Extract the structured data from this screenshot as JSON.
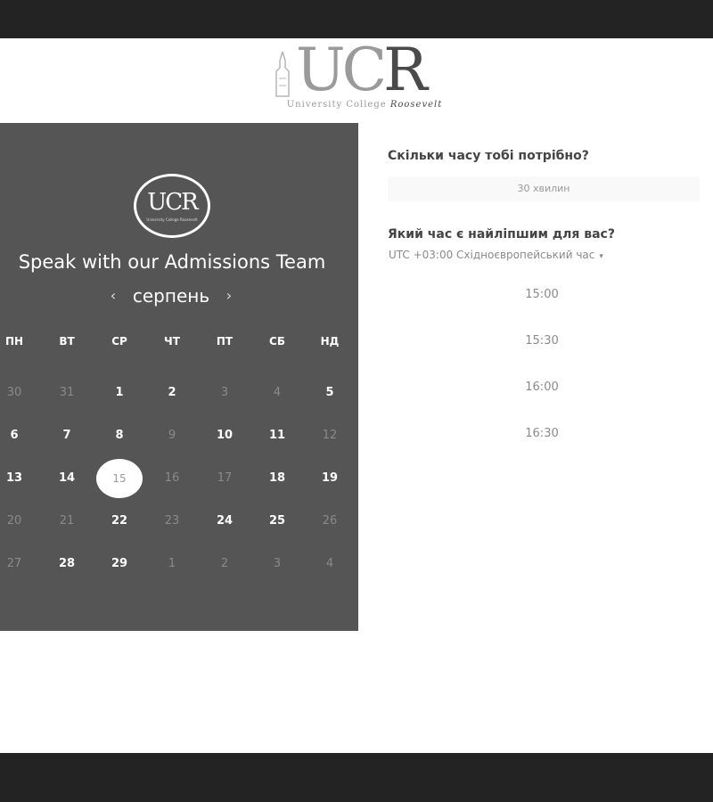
{
  "header": {
    "logo_text_main": "UC",
    "logo_text_r": "R",
    "logo_sub_a": "University College ",
    "logo_sub_b": "Roosevelt"
  },
  "panel": {
    "badge_text": "UCR",
    "badge_sub": "University College Roosevelt",
    "title": "Speak with our Admissions Team",
    "month": "серпень",
    "prev_icon": "‹",
    "next_icon": "›",
    "weekdays": [
      "ПН",
      "ВТ",
      "СР",
      "ЧТ",
      "ПТ",
      "СБ",
      "НД"
    ],
    "days": [
      [
        {
          "d": "30",
          "m": true
        },
        {
          "d": "31",
          "m": true
        },
        {
          "d": "1",
          "m": false
        },
        {
          "d": "2",
          "m": false
        },
        {
          "d": "3",
          "m": true
        },
        {
          "d": "4",
          "m": true
        },
        {
          "d": "5",
          "m": false
        }
      ],
      [
        {
          "d": "6",
          "m": false
        },
        {
          "d": "7",
          "m": false
        },
        {
          "d": "8",
          "m": false
        },
        {
          "d": "9",
          "m": true
        },
        {
          "d": "10",
          "m": false
        },
        {
          "d": "11",
          "m": false
        },
        {
          "d": "12",
          "m": true
        }
      ],
      [
        {
          "d": "13",
          "m": false
        },
        {
          "d": "14",
          "m": false
        },
        {
          "d": "15",
          "m": false,
          "s": true
        },
        {
          "d": "16",
          "m": true
        },
        {
          "d": "17",
          "m": true
        },
        {
          "d": "18",
          "m": false
        },
        {
          "d": "19",
          "m": false
        }
      ],
      [
        {
          "d": "20",
          "m": true
        },
        {
          "d": "21",
          "m": true
        },
        {
          "d": "22",
          "m": false
        },
        {
          "d": "23",
          "m": true
        },
        {
          "d": "24",
          "m": false
        },
        {
          "d": "25",
          "m": false
        },
        {
          "d": "26",
          "m": true
        }
      ],
      [
        {
          "d": "27",
          "m": true
        },
        {
          "d": "28",
          "m": false
        },
        {
          "d": "29",
          "m": false
        },
        {
          "d": "1",
          "m": true
        },
        {
          "d": "2",
          "m": true
        },
        {
          "d": "3",
          "m": true
        },
        {
          "d": "4",
          "m": true
        }
      ]
    ]
  },
  "booking": {
    "q_duration": "Скільки часу тобі потрібно?",
    "duration_value": "30 хвилин",
    "q_time": "Який час є найліпшим для вас?",
    "timezone": "UTC +03:00 Східноєвропейський час",
    "tz_caret": "▾",
    "slots": [
      "15:00",
      "15:30",
      "16:00",
      "16:30"
    ]
  },
  "colors": {
    "panel_bg": "#555555",
    "bar_bg": "#232323"
  }
}
